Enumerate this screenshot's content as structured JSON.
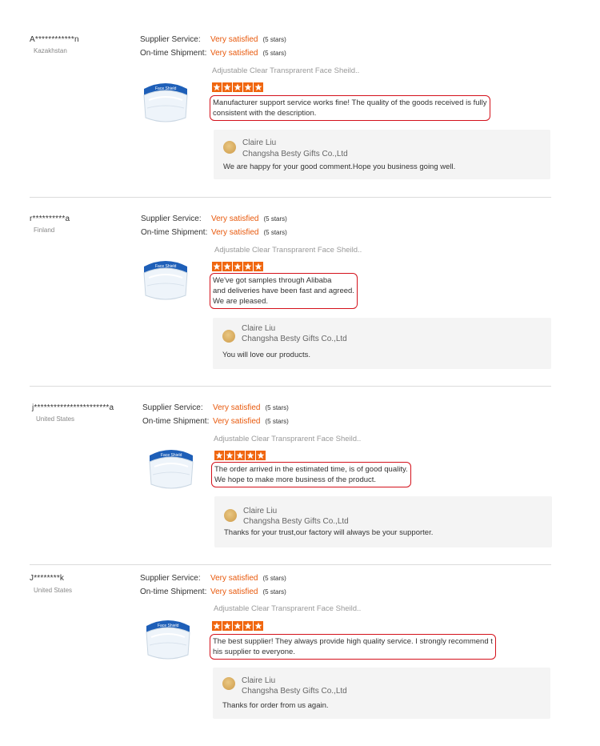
{
  "labels": {
    "supplier_service": "Supplier Service:",
    "ontime_shipment": "On-time Shipment:"
  },
  "colors": {
    "accent_orange": "#e8590c",
    "star_orange": "#f0660f",
    "highlight_red": "#d4111b",
    "reply_bg": "#f4f4f4"
  },
  "reviews": [
    {
      "buyer": "A************n",
      "country": "Kazakhstan",
      "supplier_service": {
        "value": "Very satisfied",
        "count": "(5 stars)"
      },
      "ontime_shipment": {
        "value": "Very satisfied",
        "count": "(5 stars)"
      },
      "product": "Adjustable Clear Transprarent Face Sheild..",
      "stars": 5,
      "comment": [
        "Manufacturer support service works fine! The quality of the goods received is fully",
        "consistent with the description."
      ],
      "reply": {
        "name": "Claire Liu",
        "company": "Changsha Besty Gifts Co.,Ltd",
        "text": "We are happy for your good comment.Hope you business  going well."
      }
    },
    {
      "buyer": "r**********a",
      "country": "Finland",
      "supplier_service": {
        "value": "Very satisfied",
        "count": "(5 stars)"
      },
      "ontime_shipment": {
        "value": "Very satisfied",
        "count": "(5 stars)"
      },
      "product": "Adjustable Clear Transprarent Face Sheild..",
      "stars": 5,
      "comment": [
        "We've got samples through Alibaba",
        "and deliveries have been fast and agreed.",
        "We are pleased."
      ],
      "reply": {
        "name": "Claire Liu",
        "company": "Changsha Besty Gifts Co.,Ltd",
        "text": "You will love our products."
      }
    },
    {
      "buyer": "j***********************a",
      "country": "United States",
      "supplier_service": {
        "value": "Very satisfied",
        "count": "(5 stars)"
      },
      "ontime_shipment": {
        "value": "Very satisfied",
        "count": "(5 stars)"
      },
      "product": "Adjustable Clear Transprarent Face Sheild..",
      "stars": 5,
      "comment": [
        "The order arrived in the estimated time, is of good quality.",
        "We hope to make more business of the product."
      ],
      "reply": {
        "name": "Claire Liu",
        "company": "Changsha Besty Gifts Co.,Ltd",
        "text": "Thanks for your trust,our factory will always be your supporter."
      }
    },
    {
      "buyer": "J********k",
      "country": "United States",
      "supplier_service": {
        "value": "Very satisfied",
        "count": "(5 stars)"
      },
      "ontime_shipment": {
        "value": "Very satisfied",
        "count": "(5 stars)"
      },
      "product": "Adjustable Clear Transprarent Face Sheild..",
      "stars": 5,
      "comment": [
        "The best supplier! They always provide high quality service. I strongly recommend t",
        "his supplier to everyone."
      ],
      "reply": {
        "name": "Claire Liu",
        "company": "Changsha Besty Gifts Co.,Ltd",
        "text": "Thanks for order from us again."
      }
    }
  ]
}
